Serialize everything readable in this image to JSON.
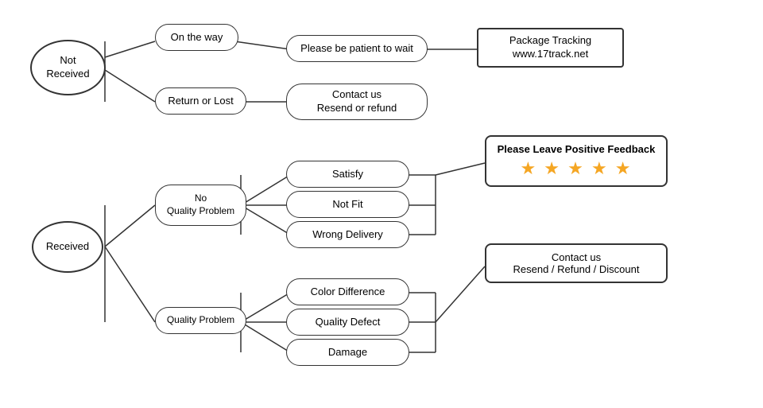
{
  "nodes": {
    "not_received": {
      "label": "Not\nReceived"
    },
    "on_the_way": {
      "label": "On the way"
    },
    "return_or_lost": {
      "label": "Return or Lost"
    },
    "patient": {
      "label": "Please be patient to wait"
    },
    "package_tracking": {
      "label": "Package Tracking\nwww.17track.net"
    },
    "contact_resend_refund": {
      "label": "Contact us\nResend or refund"
    },
    "received": {
      "label": "Received"
    },
    "no_quality": {
      "label": "No\nQuality Problem"
    },
    "quality_problem": {
      "label": "Quality Problem"
    },
    "satisfy": {
      "label": "Satisfy"
    },
    "not_fit": {
      "label": "Not Fit"
    },
    "wrong_delivery": {
      "label": "Wrong Delivery"
    },
    "color_diff": {
      "label": "Color Difference"
    },
    "quality_defect": {
      "label": "Quality Defect"
    },
    "damage": {
      "label": "Damage"
    },
    "please_feedback": {
      "label": "Please Leave Positive Feedback"
    },
    "stars": {
      "value": "★ ★ ★ ★ ★"
    },
    "contact_resend_refund2": {
      "label": "Contact us\nResend / Refund / Discount"
    }
  }
}
